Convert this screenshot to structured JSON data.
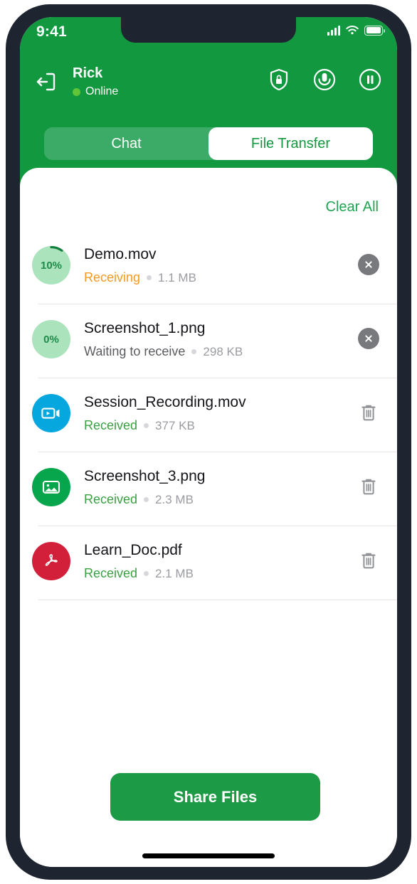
{
  "colors": {
    "brand_green": "#12993F",
    "header_green": "#12993F",
    "tab_track": "#3CAB67",
    "accent_link": "#22A352",
    "status_receiving": "#F59A1E",
    "status_received": "#3AA142",
    "status_waiting": "#5a5c60",
    "progress_fill": "#ABE3BD",
    "video_icon_bg": "#06A6DE",
    "image_icon_bg": "#08A64C",
    "pdf_icon_bg": "#D2203B",
    "frame_dark": "#1e2430"
  },
  "status_bar": {
    "time": "9:41",
    "signal_icon": "signal-bars-icon",
    "wifi_icon": "wifi-icon",
    "battery_icon": "battery-full-icon"
  },
  "header": {
    "back_icon": "exit-session-icon",
    "peer_name": "Rick",
    "peer_status": "Online",
    "online_dot": "online-status-dot",
    "actions": [
      {
        "name": "shield-lock-icon",
        "label": "Security"
      },
      {
        "name": "microphone-icon",
        "label": "Microphone"
      },
      {
        "name": "pause-icon",
        "label": "Pause"
      }
    ]
  },
  "tabs": [
    {
      "label": "Chat",
      "active": false
    },
    {
      "label": "File Transfer",
      "active": true
    }
  ],
  "card": {
    "clear_all_label": "Clear All"
  },
  "files": [
    {
      "name": "Demo.mov",
      "status": "Receiving",
      "status_kind": "receiving",
      "size": "1.1 MB",
      "icon_kind": "progress",
      "progress_label": "10%",
      "progress_pct": 10,
      "action_icon": "cancel-close-icon"
    },
    {
      "name": "Screenshot_1.png",
      "status": "Waiting to receive",
      "status_kind": "waiting",
      "size": "298 KB",
      "icon_kind": "progress",
      "progress_label": "0%",
      "progress_pct": 0,
      "action_icon": "cancel-close-icon"
    },
    {
      "name": "Session_Recording.mov",
      "status": "Received",
      "status_kind": "received",
      "size": "377 KB",
      "icon_kind": "video",
      "action_icon": "delete-trash-icon"
    },
    {
      "name": "Screenshot_3.png",
      "status": "Received",
      "status_kind": "received",
      "size": "2.3 MB",
      "icon_kind": "image",
      "action_icon": "delete-trash-icon"
    },
    {
      "name": "Learn_Doc.pdf",
      "status": "Received",
      "status_kind": "received",
      "size": "2.1 MB",
      "icon_kind": "pdf",
      "action_icon": "delete-trash-icon"
    }
  ],
  "footer": {
    "share_button_label": "Share Files"
  }
}
